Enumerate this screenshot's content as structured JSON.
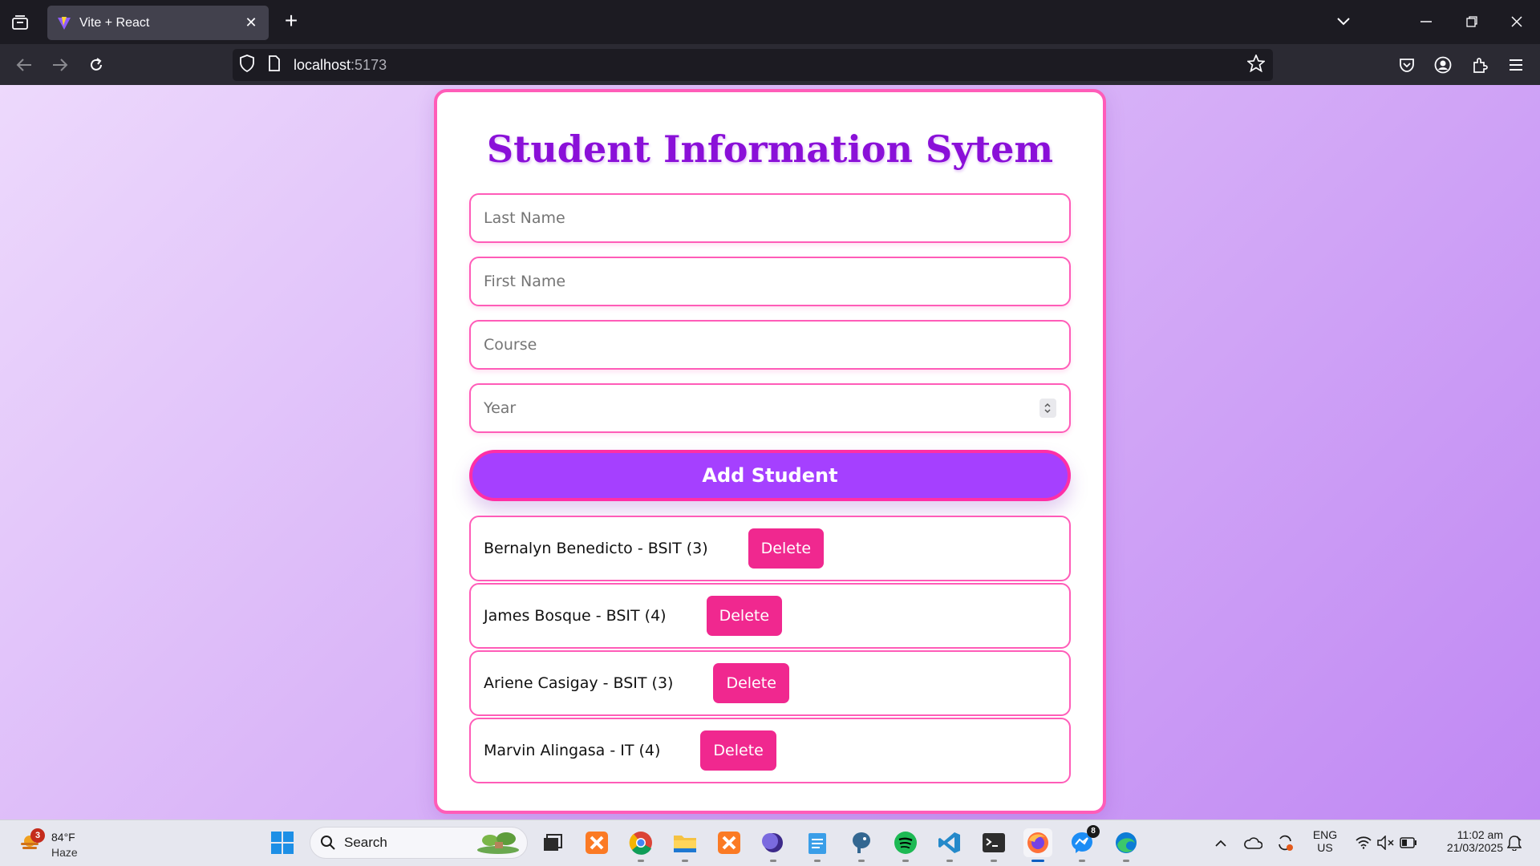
{
  "browser": {
    "tab_title": "Vite + React",
    "url_host": "localhost",
    "url_port": ":5173"
  },
  "app": {
    "title": "Student Information Sytem",
    "fields": {
      "last_name_placeholder": "Last Name",
      "first_name_placeholder": "First Name",
      "course_placeholder": "Course",
      "year_placeholder": "Year"
    },
    "add_button_label": "Add Student",
    "delete_label": "Delete",
    "students": [
      "Bernalyn Benedicto - BSIT (3)",
      "James Bosque - BSIT (4)",
      "Ariene Casigay - BSIT (3)",
      "Marvin Alingasa - IT (4)"
    ]
  },
  "taskbar": {
    "weather_temp": "84°F",
    "weather_condition": "Haze",
    "weather_badge": "3",
    "search_label": "Search",
    "language_line1": "ENG",
    "language_line2": "US",
    "time": "11:02 am",
    "date": "21/03/2025",
    "messenger_badge": "8"
  },
  "colors": {
    "accent_purple": "#a540ff",
    "title_purple": "#8a10d8",
    "border_pink": "#ff5cb8",
    "delete_pink": "#f0288f"
  }
}
